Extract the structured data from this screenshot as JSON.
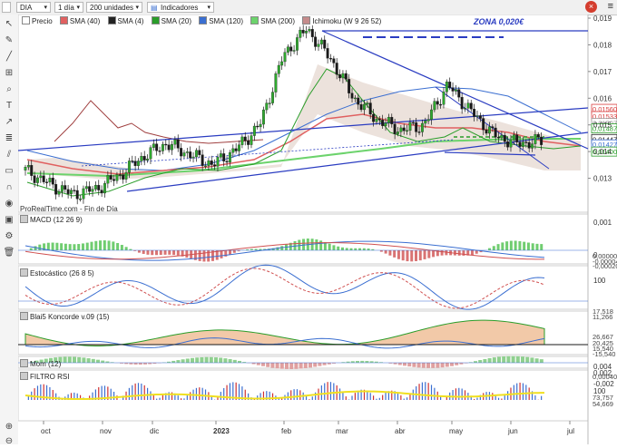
{
  "toolbar": {
    "symbol": "DIA",
    "period": "1 día",
    "units": "200 unidades",
    "indicators": "Indicadores",
    "close_glyph": "×",
    "menu_glyph": "≡"
  },
  "main_legend": [
    {
      "label": "Precio",
      "color": "#333333"
    },
    {
      "label": "SMA (40)",
      "color": "#e06060"
    },
    {
      "label": "SMA (4)",
      "color": "#222222"
    },
    {
      "label": "SMA (20)",
      "color": "#2a9d2a"
    },
    {
      "label": "SMA (120)",
      "color": "#3b6fd1"
    },
    {
      "label": "SMA (200)",
      "color": "#6cd36c"
    },
    {
      "label": "Ichimoku (W 9 26 52)",
      "color": "#c58b8b"
    }
  ],
  "annotation_zona": "ZONA 0,020€",
  "watermark": "ProRealTime.com - Fin de Día",
  "price_axis": [
    "0,019",
    "0,018",
    "0,017",
    "0,016",
    "0,015",
    "0,014",
    "0,013"
  ],
  "price_tags": [
    {
      "text": "0,01560",
      "color": "#d94040"
    },
    {
      "text": "0,01533",
      "color": "#d94040"
    },
    {
      "text": "0,01507",
      "color": "#9a9a9a"
    },
    {
      "text": "0,01487",
      "color": "#2a9d2a"
    },
    {
      "text": "0,01447",
      "color": "#222222"
    },
    {
      "text": "0,01427",
      "color": "#3b6fd1"
    },
    {
      "text": "0,01400",
      "color": "#2a9d2a"
    }
  ],
  "panels": [
    {
      "name": "MACD (12 26 9)",
      "axis": [
        "0,001",
        "0"
      ],
      "tags": [
        "0,00000",
        "-0,00004",
        "-0,00020"
      ]
    },
    {
      "name": "Estocástico (26 8 5)",
      "axis": [
        "100"
      ],
      "tags": [
        "17,518",
        "11,266"
      ]
    },
    {
      "name": "Blai5 Koncorde v.09 (15)",
      "axis": [],
      "tags": [
        "26,667",
        "20,425",
        "15,540",
        "-15,540"
      ]
    },
    {
      "name": "Mom (12)",
      "axis": [
        "0,004",
        "0,002",
        "-0,002"
      ],
      "tags": [
        "0,00040"
      ]
    },
    {
      "name": "FILTRO RSI",
      "axis": [
        "100"
      ],
      "tags": [
        "73,757",
        "54,669"
      ]
    }
  ],
  "time_axis": [
    "oct",
    "nov",
    "dic",
    "2023",
    "feb",
    "mar",
    "abr",
    "may",
    "jun",
    "jul"
  ],
  "tools": [
    "cursor-icon",
    "pencil-icon",
    "line-icon",
    "measure-icon",
    "zoom-icon",
    "text-icon",
    "arrow-icon",
    "fibonacci-icon",
    "channel-icon",
    "shape-icon",
    "magnet-icon",
    "eye-icon",
    "lock-icon",
    "settings-icon",
    "trash-icon"
  ],
  "chart_data": {
    "type": "line",
    "title": "DIA",
    "price_range": [
      0.012,
      0.019
    ],
    "series": [
      {
        "name": "Precio",
        "values": [
          0.0133,
          0.0128,
          0.0124,
          0.0126,
          0.0131,
          0.0138,
          0.0143,
          0.0139,
          0.0135,
          0.0141,
          0.015,
          0.0176,
          0.0186,
          0.0175,
          0.016,
          0.0152,
          0.0148,
          0.015,
          0.0165,
          0.0155,
          0.0146,
          0.0143,
          0.0144
        ]
      }
    ]
  }
}
